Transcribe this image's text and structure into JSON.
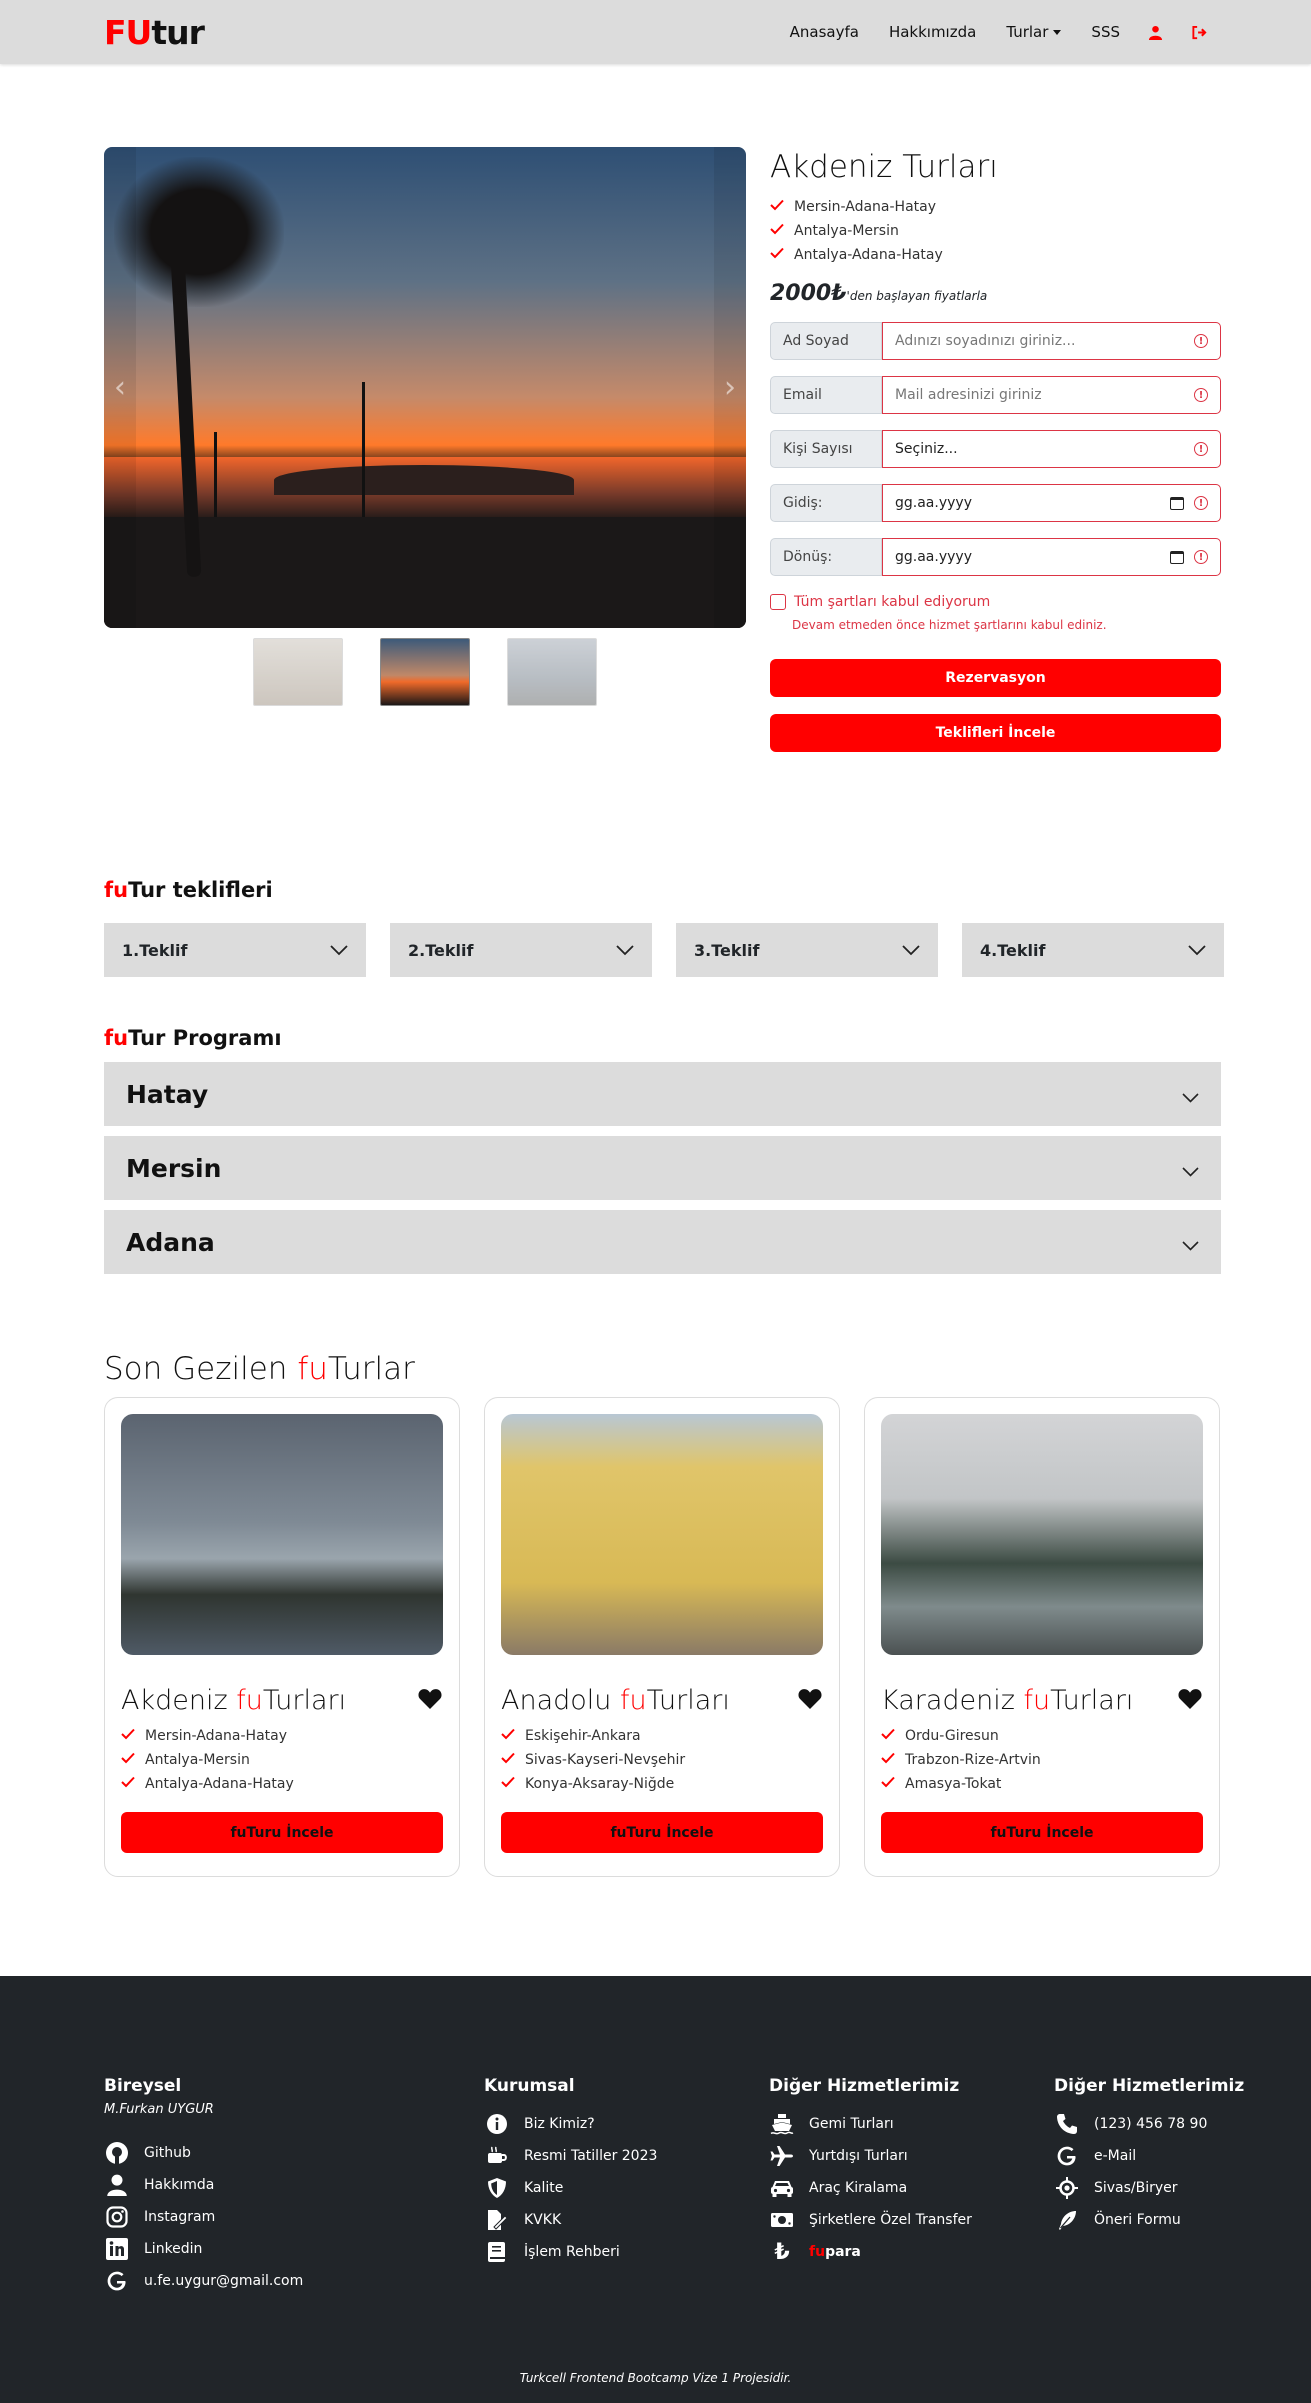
{
  "navbar": {
    "brand_fu": "FU",
    "brand_tur": "tur",
    "links": [
      "Anasayfa",
      "Hakkımızda",
      "Turlar",
      "SSS"
    ]
  },
  "hero": {
    "title": "Akdeniz Turları",
    "routes": [
      "Mersin-Adana-Hatay",
      "Antalya-Mersin",
      "Antalya-Adana-Hatay"
    ],
    "price": "2000₺",
    "price_suffix": "'den başlayan fiyatlarla",
    "fields": [
      {
        "label": "Ad Soyad",
        "placeholder": "Adınızı soyadınızı giriniz..."
      },
      {
        "label": "Email",
        "placeholder": "Mail adresinizi giriniz"
      },
      {
        "label": "Kişi Sayısı",
        "placeholder": "Seçiniz..."
      },
      {
        "label": "Gidiş:",
        "placeholder": "gg.aa.yyyy"
      },
      {
        "label": "Dönüş:",
        "placeholder": "gg.aa.yyyy"
      }
    ],
    "terms_label": "Tüm şartları kabul ediyorum",
    "terms_error": "Devam etmeden önce hizmet şartlarını kabul ediniz.",
    "btn_reserve": "Rezervasyon",
    "btn_offers": "Teklifleri İncele"
  },
  "offers": {
    "title_fu": "fu",
    "title_rest": "Tur teklifleri",
    "items": [
      "1.Teklif",
      "2.Teklif",
      "3.Teklif",
      "4.Teklif"
    ]
  },
  "program": {
    "title_fu": "fu",
    "title_rest": "Tur Programı",
    "items": [
      "Hatay",
      "Mersin",
      "Adana"
    ]
  },
  "recent": {
    "title_a": "Son Gezilen ",
    "title_fu": "fu",
    "title_b": "Turlar",
    "cards": [
      {
        "name": "Akdeniz ",
        "routes": [
          "Mersin-Adana-Hatay",
          "Antalya-Mersin",
          "Antalya-Adana-Hatay"
        ]
      },
      {
        "name": "Anadolu ",
        "routes": [
          "Eskişehir-Ankara",
          "Sivas-Kayseri-Nevşehir",
          "Konya-Aksaray-Niğde"
        ]
      },
      {
        "name": "Karadeniz ",
        "routes": [
          "Ordu-Giresun",
          "Trabzon-Rize-Artvin",
          "Amasya-Tokat"
        ]
      }
    ],
    "card_fu": "fu",
    "card_turlari": "Turları",
    "btn_fu": "fu",
    "btn_rest": "Turu İncele"
  },
  "footer": {
    "col1": {
      "title": "Bireysel",
      "subtitle": "M.Furkan UYGUR",
      "items": [
        "Github",
        "Hakkımda",
        "Instagram",
        "Linkedin",
        "u.fe.uygur@gmail.com"
      ]
    },
    "col2": {
      "title": "Kurumsal",
      "items": [
        "Biz Kimiz?",
        "Resmi Tatiller 2023",
        "Kalite",
        "KVKK",
        "İşlem Rehberi"
      ]
    },
    "col3": {
      "title": "Diğer Hizmetlerimiz",
      "items": [
        "Gemi Turları",
        "Yurtdışı Turları",
        "Araç Kiralama",
        "Şirketlere Özel Transfer"
      ],
      "fupara_fu": "fu",
      "fupara_rest": "para"
    },
    "col4": {
      "title": "Diğer Hizmetlerimiz",
      "items": [
        "(123) 456 78 90",
        "e-Mail",
        "Sivas/Biryer",
        "Öneri Formu"
      ]
    },
    "footnote": "Turkcell Frontend Bootcamp Vize 1 Projesidir."
  },
  "colors": {
    "accent": "#ff0000",
    "navbar": "#dcdcdc",
    "footer": "#212529",
    "error": "#dc3545"
  }
}
